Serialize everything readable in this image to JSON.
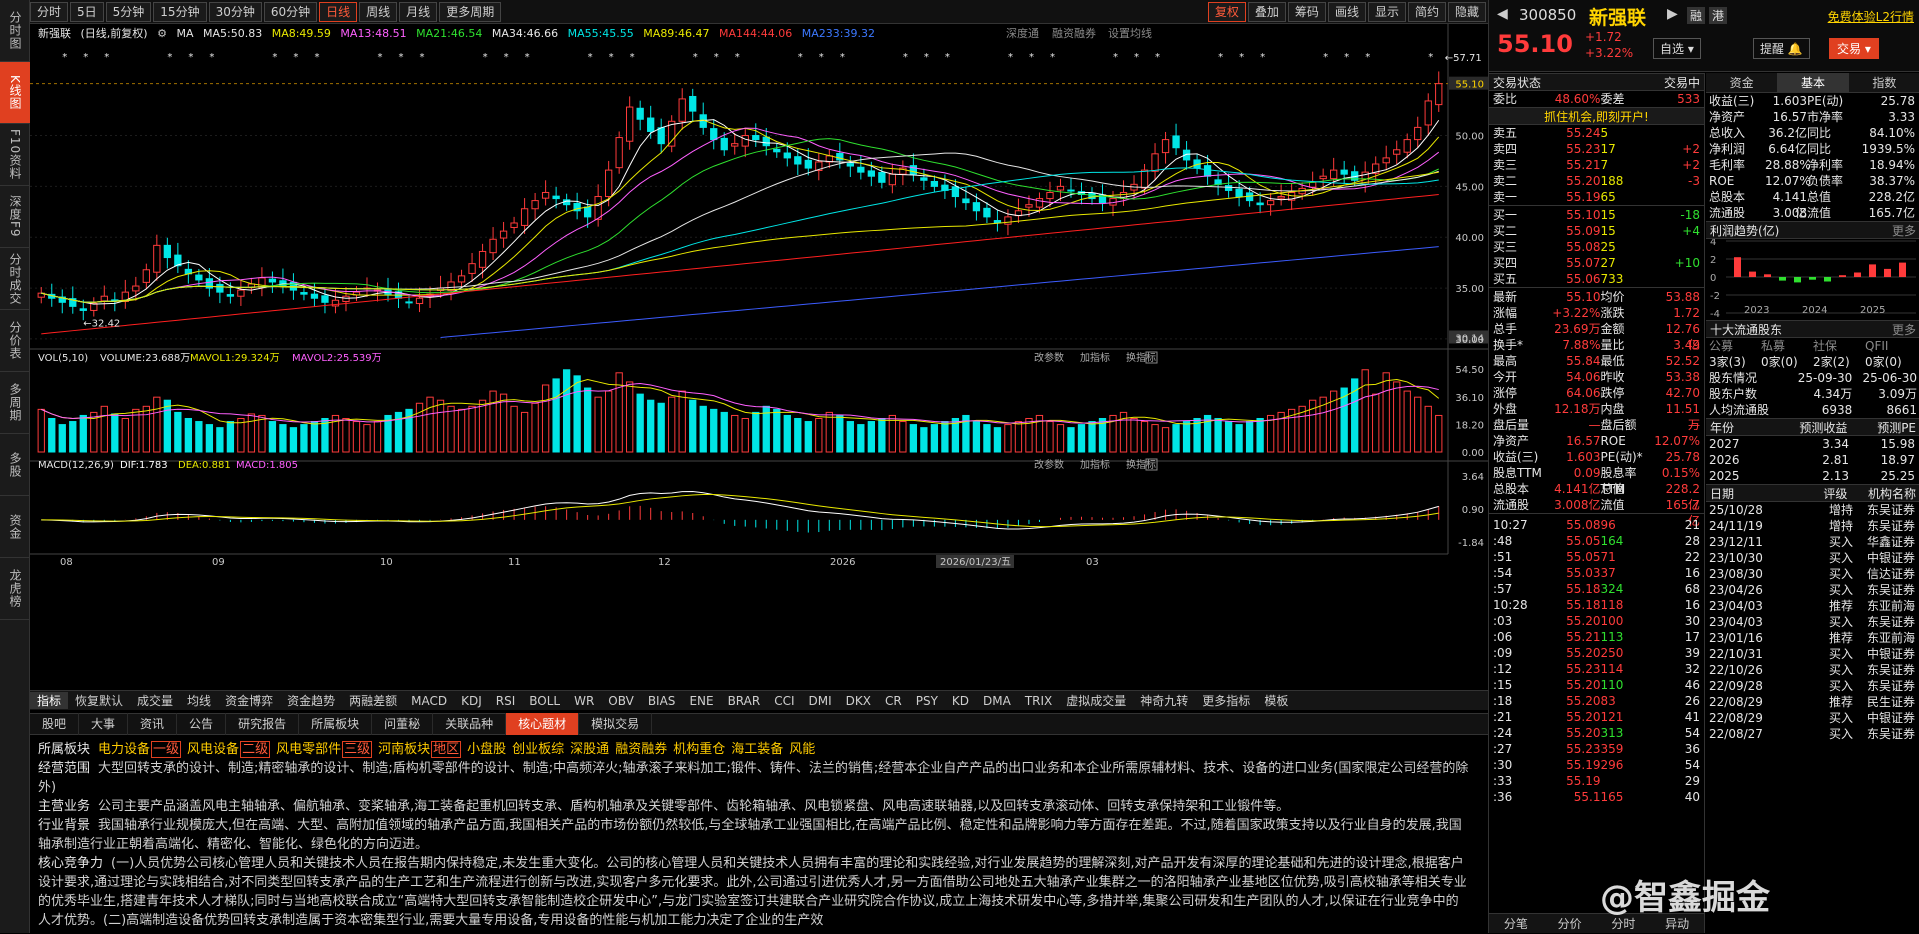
{
  "left_tabs": [
    "分时图",
    "K线图",
    "F10资料",
    "深度F9",
    "分时成交",
    "分价表",
    "多周期",
    "多股",
    "资金",
    "龙虎榜"
  ],
  "periods": [
    "分时",
    "5日",
    "5分钟",
    "15分钟",
    "30分钟",
    "60分钟",
    "日线",
    "周线",
    "月线",
    "更多周期"
  ],
  "tool_right": [
    "复权",
    "叠加",
    "筹码",
    "画线",
    "显示",
    "简约",
    "隐藏"
  ],
  "info": {
    "name": "新强联",
    "mode": "(日线,前复权)",
    "ma_label": "MA",
    "ma5": "MA5:50.83",
    "ma8": "MA8:49.59",
    "ma13": "MA13:48.51",
    "ma21": "MA21:46.54",
    "ma34": "MA34:46.66",
    "ma55": "MA55:45.55",
    "ma89": "MA89:46.47",
    "ma144": "MA144:44.06",
    "ma233": "MA233:39.32",
    "r1": "深度通",
    "r2": "融资融券",
    "r3": "设置均线"
  },
  "price_labels": [
    "55.10",
    "50.00",
    "45.00",
    "40.00",
    "35.00",
    "30.14",
    "30.00"
  ],
  "hi_label": "57.71",
  "lo_label": "32.42",
  "vol": {
    "title": "VOL(5,10)",
    "v1": "VOLUME:23.688万",
    "v2": "MAVOL1:29.324万",
    "v3": "MAVOL2:25.539万",
    "axis": [
      "54.50",
      "36.10",
      "18.20",
      "0.00"
    ]
  },
  "macd": {
    "title": "MACD(12,26,9)",
    "dif": "DIF:1.783",
    "dea": "DEA:0.881",
    "m": "MACD:1.805",
    "axis": [
      "3.64",
      "0.90",
      "-1.84"
    ]
  },
  "panel_btns": [
    "改参数",
    "加指标",
    "换指标"
  ],
  "xaxis": [
    "08",
    "09",
    "10",
    "11",
    "12",
    "2026",
    "2026/01/23/五",
    "03"
  ],
  "idx_tabs": [
    "指标",
    "恢复默认",
    "成交量",
    "均线",
    "资金博弈",
    "资金趋势",
    "两融差额",
    "MACD",
    "KDJ",
    "RSI",
    "BOLL",
    "WR",
    "OBV",
    "BIAS",
    "ENE",
    "BRAR",
    "CCI",
    "DMI",
    "DKX",
    "CR",
    "PSY",
    "KD",
    "DMA",
    "TRIX",
    "虚拟成交量",
    "神奇九转",
    "更多指标",
    "模板"
  ],
  "f_tabs": [
    "股吧",
    "大事",
    "资讯",
    "公告",
    "研究报告",
    "所属板块",
    "问董秘",
    "关联品种",
    "核心题材",
    "模拟交易"
  ],
  "f10": {
    "l1": "所属板块",
    "tags": [
      "电力设备",
      "风电设备",
      "风电零部件",
      "河南板块",
      "小盘股",
      "创业板综",
      "深股通",
      "融资融券",
      "机构重仓",
      "海工装备",
      "风能"
    ],
    "boxes": [
      "一级",
      "二级",
      "三级",
      "地区"
    ],
    "l2": "经营范围",
    "t2": "大型回转支承的设计、制造;精密轴承的设计、制造;盾构机零部件的设计、制造;中高频淬火;轴承滚子来料加工;锻件、铸件、法兰的销售;经营本企业自产产品的出口业务和本企业所需原辅材料、技术、设备的进口业务(国家限定公司经营的除外)",
    "l3": "主营业务",
    "t3": "公司主要产品涵盖风电主轴轴承、偏航轴承、变桨轴承,海工装备起重机回转支承、盾构机轴承及关键零部件、齿轮箱轴承、风电锁紧盘、风电高速联轴器,以及回转支承滚动体、回转支承保持架和工业锻件等。",
    "l4": "行业背景",
    "t4": "我国轴承行业规模庞大,但在高端、大型、高附加值领域的轴承产品方面,我国相关产品的市场份额仍然较低,与全球轴承工业强国相比,在高端产品比例、稳定性和品牌影响力等方面存在差距。不过,随着国家政策支持以及行业自身的发展,我国轴承制造行业正朝着高端化、精密化、智能化、绿色化的方向迈进。",
    "l5": "核心竞争力",
    "t5": "(一)人员优势公司核心管理人员和关键技术人员在报告期内保持稳定,未发生重大变化。公司的核心管理人员和关键技术人员拥有丰富的理论和实践经验,对行业发展趋势的理解深刻,对产品开发有深厚的理论基础和先进的设计理念,根据客户设计要求,通过理论与实践相结合,对不同类型回转支承产品的生产工艺和生产流程进行创新与改进,实现客户多元化要求。此外,公司通过引进优秀人才,另一方面借助公司地处五大轴承产业集群之一的洛阳轴承产业基地区位优势,吸引高校轴承等相关专业的优秀毕业生,搭建青年技术人才梯队;同时与当地高校联合成立“高端特大型回转支承智能制造校企研发中心”,与龙门实验室签订共建联合产业研究院合作协议,成立上海技术研发中心等,多措并举,集聚公司研发和生产团队的人才,以保证在行业竞争中的人才优势。(二)高端制造设备优势回转支承制造属于资本密集型行业,需要大量专用设备,专用设备的性能与机加工能力决定了企业的生产效"
  },
  "header": {
    "code": "300850",
    "name": "新强联",
    "btn1": "融",
    "btn2": "港",
    "trial": "免费体验L2行情",
    "price": "55.10",
    "chg": "+1.72",
    "pct": "+3.22%",
    "sel": "自选",
    "remind": "提醒",
    "trade": "交易"
  },
  "quote": {
    "s1": "交易状态",
    "s2": "交易中",
    "wb": "委比",
    "wbv": "48.60%",
    "wc": "委差",
    "wcv": "533",
    "ad": "抓住机会,即刻开户!",
    "sells": [
      [
        "卖五",
        "55.24",
        "5",
        ""
      ],
      [
        "卖四",
        "55.23",
        "17",
        "+2"
      ],
      [
        "卖三",
        "55.21",
        "7",
        "+2"
      ],
      [
        "卖二",
        "55.20",
        "188",
        "-3"
      ],
      [
        "卖一",
        "55.19",
        "65",
        ""
      ]
    ],
    "buys": [
      [
        "买一",
        "55.10",
        "15",
        "-18"
      ],
      [
        "买二",
        "55.09",
        "15",
        "+4"
      ],
      [
        "买三",
        "55.08",
        "25",
        ""
      ],
      [
        "买四",
        "55.07",
        "27",
        "+10"
      ],
      [
        "买五",
        "55.06",
        "733",
        ""
      ]
    ],
    "stats": [
      [
        "最新",
        "55.10",
        "均价",
        "53.88"
      ],
      [
        "涨幅",
        "+3.22%",
        "涨跌",
        "1.72"
      ],
      [
        "总手",
        "23.69万",
        "金额",
        "12.76亿"
      ],
      [
        "换手*",
        "7.88%",
        "量比",
        "3.49"
      ],
      [
        "最高",
        "55.84",
        "最低",
        "52.52"
      ],
      [
        "今开",
        "54.06",
        "昨收",
        "53.38"
      ],
      [
        "涨停",
        "64.06",
        "跌停",
        "42.70"
      ],
      [
        "外盘",
        "12.18万",
        "内盘",
        "11.51万"
      ],
      [
        "盘后量",
        "—",
        "盘后额",
        "—"
      ],
      [
        "净资产",
        "16.57",
        "ROE",
        "12.07%"
      ],
      [
        "收益(三)",
        "1.603",
        "PE(动)*",
        "25.78"
      ],
      [
        "股息TTM",
        "0.09",
        "股息率TTM",
        "0.15%"
      ],
      [
        "总股本",
        "4.141亿",
        "总值",
        "228.2亿"
      ],
      [
        "流通股",
        "3.008亿",
        "流值",
        "165.7亿"
      ]
    ],
    "ticks": [
      [
        "10:27",
        "55.08",
        "96",
        "21"
      ],
      [
        ":48",
        "55.05",
        "164",
        "28"
      ],
      [
        ":51",
        "55.05",
        "71",
        "22"
      ],
      [
        ":54",
        "55.03",
        "37",
        "16"
      ],
      [
        ":57",
        "55.18",
        "324",
        "68"
      ],
      [
        "10:28",
        "55.18",
        "118",
        "16"
      ],
      [
        ":03",
        "55.20",
        "100",
        "30"
      ],
      [
        ":06",
        "55.21",
        "113",
        "17"
      ],
      [
        ":09",
        "55.20",
        "250",
        "39"
      ],
      [
        ":12",
        "55.23",
        "114",
        "32"
      ],
      [
        ":15",
        "55.20",
        "110",
        "46"
      ],
      [
        ":18",
        "55.20",
        "83",
        "26"
      ],
      [
        ":21",
        "55.20",
        "121",
        "41"
      ],
      [
        ":24",
        "55.20",
        "313",
        "54"
      ],
      [
        ":27",
        "55.23",
        "359",
        "36"
      ],
      [
        ":30",
        "55.19",
        "296",
        "54"
      ],
      [
        ":33",
        "55.19",
        "",
        "29"
      ],
      [
        ":36",
        "55.1",
        "165",
        "40"
      ]
    ],
    "bottom": [
      "分笔",
      "分价",
      "分时",
      "异动"
    ]
  },
  "fund": {
    "tabs": [
      "资金",
      "基本",
      "指数"
    ],
    "kv": [
      [
        "收益(三)",
        "1.603",
        "PE(动)",
        "25.78"
      ],
      [
        "净资产",
        "16.57",
        "市净率",
        "3.33"
      ],
      [
        "总收入",
        "36.2亿",
        "同比",
        "84.10%"
      ],
      [
        "净利润",
        "6.64亿",
        "同比",
        "1939.5%"
      ],
      [
        "毛利率",
        "28.88%",
        "净利率",
        "18.94%"
      ],
      [
        "ROE",
        "12.07%",
        "负债率",
        "38.37%"
      ],
      [
        "总股本",
        "4.141亿",
        "总值",
        "228.2亿"
      ],
      [
        "流通股",
        "3.008亿",
        "流值",
        "165.7亿"
      ]
    ],
    "trend_title": "利润趋势(亿)",
    "more": "更多",
    "years": [
      "2023",
      "2024",
      "2025"
    ],
    "yaxis": [
      "4",
      "2",
      "0",
      "-2",
      "-4"
    ],
    "holders_title": "十大流通股东",
    "holder_cols": [
      "公募",
      "私募",
      "社保",
      "QFII"
    ],
    "holder_vals": [
      "3家(3)",
      "0家(0)",
      "2家(2)",
      "0家(0)"
    ],
    "hkv": [
      [
        "股东情况",
        "25-09-30",
        "25-06-30"
      ],
      [
        "股东户数",
        "4.34万",
        "3.09万"
      ],
      [
        "人均流通股",
        "6938",
        "8661"
      ]
    ],
    "fc_cols": [
      "年份",
      "预测收益",
      "预测PE"
    ],
    "fc": [
      [
        "2027",
        "3.34",
        "15.98"
      ],
      [
        "2026",
        "2.81",
        "18.97"
      ],
      [
        "2025",
        "2.13",
        "25.25"
      ]
    ],
    "rt_cols": [
      "日期",
      "评级",
      "机构名称"
    ],
    "ratings": [
      [
        "25/10/28",
        "增持",
        "东吴证券"
      ],
      [
        "24/11/19",
        "增持",
        "东吴证券"
      ],
      [
        "23/12/11",
        "买入",
        "华鑫证券"
      ],
      [
        "23/10/30",
        "买入",
        "中银证券"
      ],
      [
        "23/08/30",
        "买入",
        "信达证券"
      ],
      [
        "23/04/26",
        "买入",
        "东吴证券"
      ],
      [
        "23/04/03",
        "推荐",
        "东亚前海"
      ],
      [
        "23/04/03",
        "买入",
        "东吴证券"
      ],
      [
        "23/01/16",
        "推荐",
        "东亚前海"
      ],
      [
        "22/10/31",
        "买入",
        "中银证券"
      ],
      [
        "22/10/26",
        "买入",
        "东吴证券"
      ],
      [
        "22/09/28",
        "买入",
        "东吴证券"
      ],
      [
        "22/08/29",
        "推荐",
        "民生证券"
      ],
      [
        "22/08/29",
        "买入",
        "中银证券"
      ],
      [
        "22/08/27",
        "买入",
        "东吴证券"
      ]
    ]
  },
  "watermark": "@智鑫掘金",
  "chart_data": {
    "type": "candlestick",
    "price_ylim": [
      29.5,
      59
    ],
    "last": 55.1,
    "high": 57.71,
    "low": 32.42,
    "closes": [
      34.5,
      34.0,
      33.6,
      33.2,
      32.8,
      33.5,
      34.2,
      33.8,
      34.6,
      35.2,
      36.8,
      39.2,
      38.0,
      37.2,
      36.4,
      35.8,
      35.0,
      34.6,
      34.2,
      34.8,
      35.4,
      36.0,
      35.6,
      35.2,
      34.8,
      34.4,
      34.0,
      33.6,
      33.8,
      34.2,
      34.6,
      35.0,
      34.8,
      34.4,
      34.0,
      33.6,
      34.0,
      34.4,
      35.0,
      35.6,
      36.2,
      37.4,
      38.6,
      39.8,
      40.6,
      41.4,
      42.8,
      43.6,
      44.4,
      43.8,
      43.2,
      42.6,
      42.0,
      44.0,
      46.6,
      49.8,
      52.8,
      51.6,
      50.4,
      49.2,
      51.4,
      53.6,
      52.4,
      50.8,
      49.6,
      48.6,
      49.2,
      50.0,
      49.6,
      49.0,
      48.4,
      47.8,
      47.2,
      46.8,
      47.4,
      48.0,
      47.6,
      47.0,
      46.4,
      46.0,
      45.4,
      46.2,
      46.8,
      46.2,
      45.6,
      45.0,
      44.6,
      44.0,
      43.4,
      42.6,
      42.0,
      41.4,
      42.0,
      42.6,
      43.2,
      43.8,
      44.4,
      45.0,
      44.6,
      44.2,
      43.8,
      43.4,
      43.8,
      44.4,
      45.2,
      46.6,
      48.2,
      49.6,
      48.8,
      47.6,
      46.8,
      46.0,
      45.2,
      44.6,
      44.0,
      43.6,
      43.2,
      43.6,
      44.0,
      44.4,
      44.8,
      45.4,
      46.0,
      46.6,
      46.2,
      45.6,
      46.4,
      47.2,
      47.8,
      48.6,
      49.6,
      50.8,
      53.4,
      55.1
    ],
    "volume_max": 54.5,
    "vols": [
      28,
      22,
      18,
      20,
      24,
      26,
      30,
      25,
      22,
      28,
      30,
      36,
      34,
      26,
      22,
      20,
      18,
      16,
      20,
      22,
      25,
      24,
      20,
      18,
      16,
      18,
      20,
      22,
      24,
      22,
      20,
      18,
      20,
      24,
      26,
      28,
      32,
      36,
      34,
      30,
      28,
      30,
      34,
      40,
      38,
      30,
      26,
      32,
      44,
      48,
      54,
      50,
      42,
      36,
      40,
      52,
      46,
      38,
      34,
      32,
      36,
      40,
      34,
      30,
      28,
      26,
      24,
      22,
      26,
      30,
      28,
      24,
      22,
      20,
      22,
      26,
      24,
      20,
      18,
      20,
      22,
      24,
      20,
      18,
      16,
      18,
      20,
      22,
      24,
      20,
      18,
      16,
      18,
      20,
      22,
      24,
      20,
      18,
      16,
      18,
      20,
      22,
      24,
      26,
      22,
      20,
      18,
      16,
      18,
      20,
      22,
      24,
      22,
      20,
      18,
      20,
      22,
      24,
      26,
      28,
      30,
      34,
      36,
      40,
      42,
      48,
      54,
      38,
      52,
      46,
      40,
      36,
      30,
      24
    ],
    "macd_ylim": [
      -1.84,
      3.64
    ]
  }
}
